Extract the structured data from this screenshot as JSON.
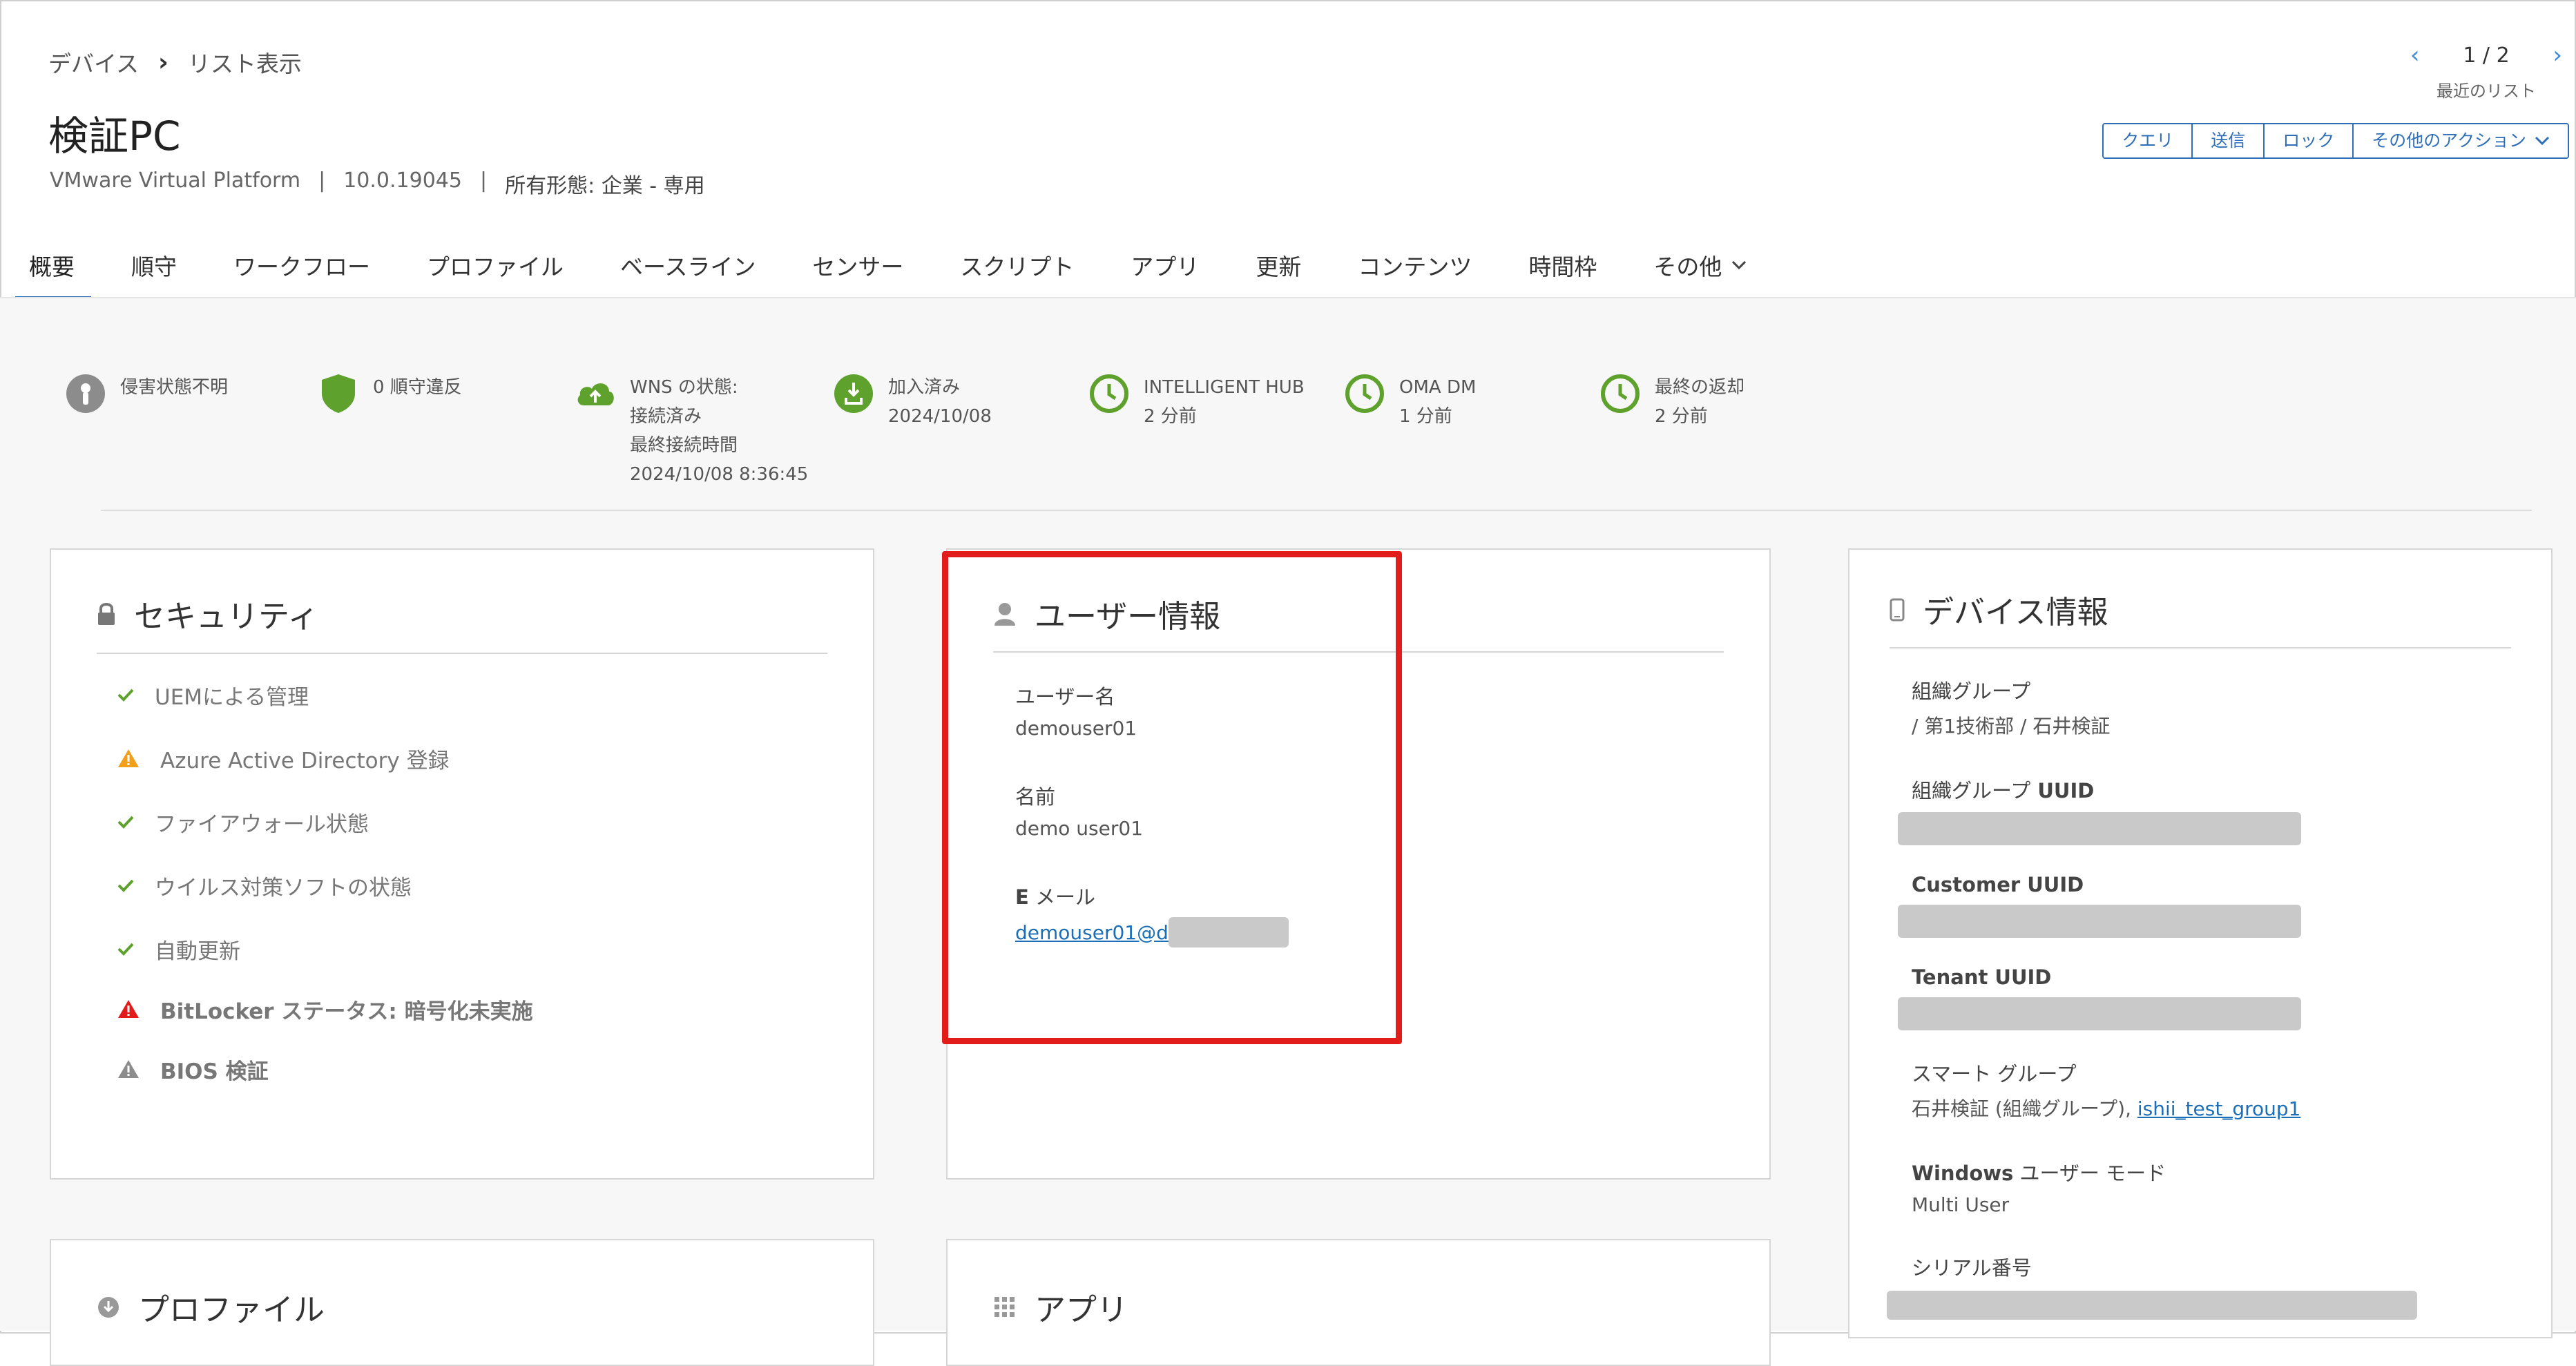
{
  "breadcrumb": {
    "root": "デバイス",
    "current": "リスト表示"
  },
  "device": {
    "title": "検証PC",
    "platform": "VMware Virtual Platform",
    "version": "10.0.19045",
    "ownership": "所有形態: 企業 - 専用"
  },
  "pager": {
    "position": "1 / 2",
    "recent": "最近のリスト"
  },
  "actions": {
    "query": "クエリ",
    "send": "送信",
    "lock": "ロック",
    "more": "その他のアクション"
  },
  "tabs": [
    "概要",
    "順守",
    "ワークフロー",
    "プロファイル",
    "ベースライン",
    "センサー",
    "スクリプト",
    "アプリ",
    "更新",
    "コンテンツ",
    "時間枠",
    "その他"
  ],
  "status": {
    "compromised": "侵害状態不明",
    "compliance": "0 順守違反",
    "wns": {
      "l1": "WNS の状態:",
      "l2": "接続済み",
      "l3": "最終接続時間",
      "l4": "2024/10/08 8:36:45"
    },
    "enrolled": {
      "l1": "加入済み",
      "l2": "2024/10/08"
    },
    "hub": {
      "l1": "INTELLIGENT HUB",
      "l2": "2 分前"
    },
    "omadm": {
      "l1": "OMA DM",
      "l2": "1 分前"
    },
    "lastseen": {
      "l1": "最終の返却",
      "l2": "2 分前"
    }
  },
  "security": {
    "title": "セキュリティ",
    "items": [
      "UEMによる管理",
      "Azure Active Directory 登録",
      "ファイアウォール状態",
      "ウイルス対策ソフトの状態",
      "自動更新",
      "BitLocker ステータス: 暗号化未実施",
      "BIOS 検証"
    ]
  },
  "user": {
    "title": "ユーザー情報",
    "username_label": "ユーザー名",
    "username": "demouser01",
    "name_label": "名前",
    "name": "demo user01",
    "email_label_bold": "E",
    "email_label_rest": " メール",
    "email": "demouser01@d"
  },
  "deviceinfo": {
    "title": "デバイス情報",
    "org_group_label": "組織グループ",
    "org_group": "/ 第1技術部 / 石井検証",
    "org_uuid_label": "組織グループ",
    "org_uuid_label_bold": " UUID",
    "customer_uuid_label": "Customer UUID",
    "tenant_uuid_label": "Tenant UUID",
    "smart_group_label": "スマート グループ",
    "smart_group_text": "石井検証 (組織グループ), ",
    "smart_group_link": "ishii_test_group1",
    "win_mode_label_bold": "Windows",
    "win_mode_label_rest": " ユーザー モード",
    "win_mode": "Multi User",
    "serial_label": "シリアル番号"
  },
  "profile": {
    "title": "プロファイル"
  },
  "apps": {
    "title": "アプリ"
  },
  "colors": {
    "accent": "#2f6fba",
    "green": "#5ea12c",
    "warn": "#f2a01c",
    "error": "#e21b1b",
    "highlight": "#e21b1b"
  }
}
